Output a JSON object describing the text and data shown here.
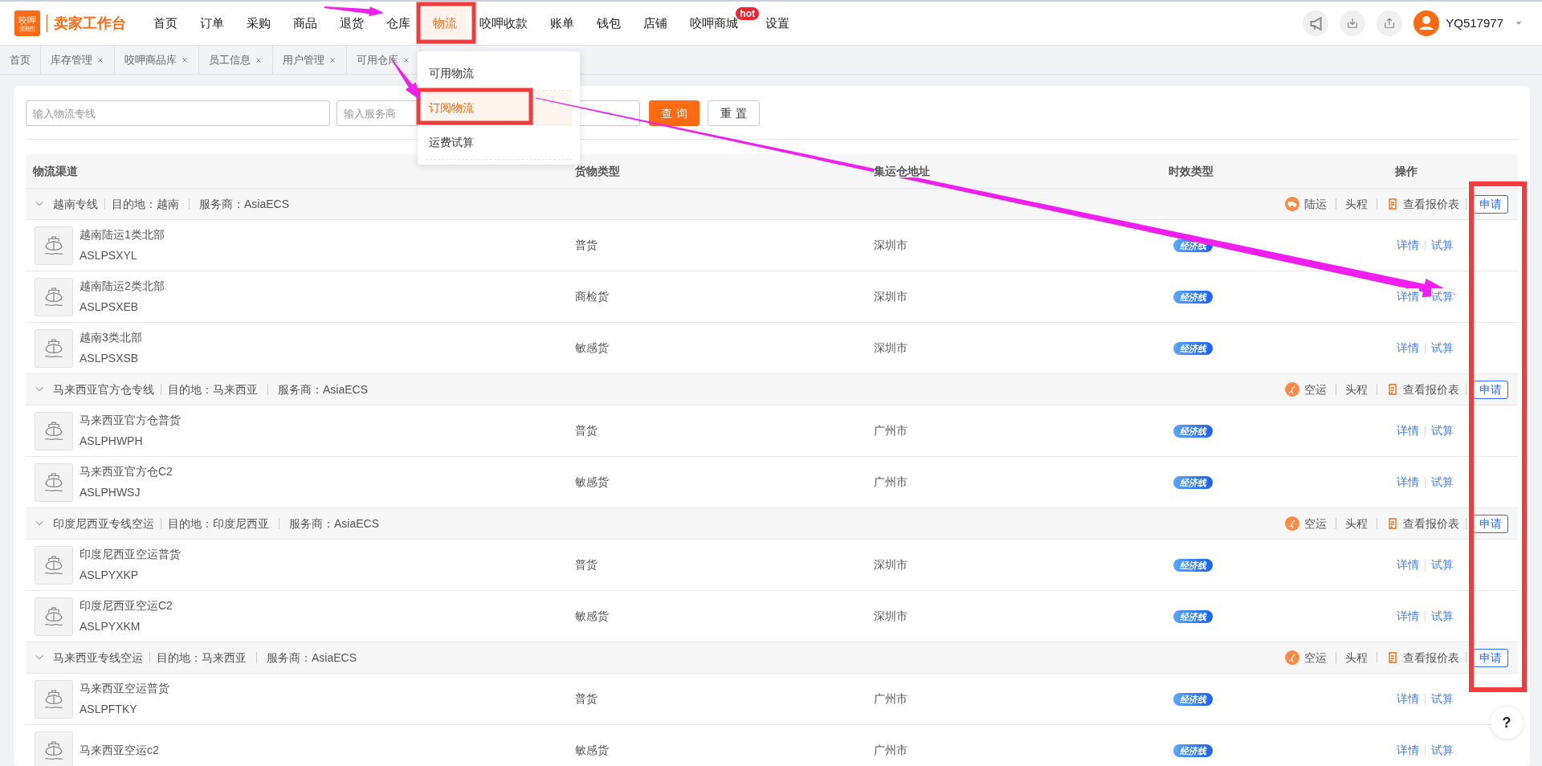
{
  "header": {
    "logo_mark": "咬呷",
    "logo_sub": "ERP",
    "app_title": "卖家工作台",
    "nav": [
      {
        "label": "首页",
        "selected": false
      },
      {
        "label": "订单",
        "selected": false
      },
      {
        "label": "采购",
        "selected": false
      },
      {
        "label": "商品",
        "selected": false
      },
      {
        "label": "退货",
        "selected": false
      },
      {
        "label": "仓库",
        "selected": false
      },
      {
        "label": "物流",
        "selected": true
      },
      {
        "label": "咬呷收款",
        "selected": false
      },
      {
        "label": "账单",
        "selected": false
      },
      {
        "label": "钱包",
        "selected": false
      },
      {
        "label": "店铺",
        "selected": false
      },
      {
        "label": "咬呷商城",
        "selected": false,
        "badge": "hot"
      },
      {
        "label": "设置",
        "selected": false
      }
    ],
    "user": "YQ517977"
  },
  "tabs": [
    {
      "label": "首页",
      "closable": false
    },
    {
      "label": "库存管理",
      "closable": true
    },
    {
      "label": "咬呷商品库",
      "closable": true
    },
    {
      "label": "员工信息",
      "closable": true
    },
    {
      "label": "用户管理",
      "closable": true
    },
    {
      "label": "可用仓库",
      "closable": true
    }
  ],
  "dropdown": {
    "items": [
      {
        "label": "可用物流",
        "selected": false
      },
      {
        "label": "订阅物流",
        "selected": true
      },
      {
        "label": "运费试算",
        "selected": false
      }
    ]
  },
  "filters": {
    "fields": [
      {
        "placeholder": "输入物流专线"
      },
      {
        "placeholder": "输入服务商"
      }
    ],
    "buttons": [
      {
        "label": "查询",
        "kind": "primary"
      },
      {
        "label": "重置",
        "kind": "default"
      }
    ]
  },
  "table": {
    "columns": [
      "物流渠道",
      "货物类型",
      "集运仓地址",
      "时效类型",
      "操作"
    ],
    "groups": [
      {
        "title": "越南专线",
        "destination": "目的地：越南",
        "provider": "服务商：AsiaECS",
        "expanded": true,
        "transport": {
          "kind": "land",
          "label": "陆运"
        },
        "leg": "头程",
        "quote": "查看报价表",
        "apply": "申请",
        "rows": [
          {
            "name": "越南陆运1类北部",
            "code": "ASLPSXYL",
            "cargo": "普货",
            "warehouse": "深圳市",
            "badge": "经济线",
            "actions": [
              "详情",
              "试算"
            ]
          },
          {
            "name": "越南陆运2类北部",
            "code": "ASLPSXEB",
            "cargo": "商检货",
            "warehouse": "深圳市",
            "badge": "经济线",
            "actions": [
              "详情",
              "试算"
            ]
          },
          {
            "name": "越南3类北部",
            "code": "ASLPSXSB",
            "cargo": "敏感货",
            "warehouse": "深圳市",
            "badge": "经济线",
            "actions": [
              "详情",
              "试算"
            ]
          }
        ]
      },
      {
        "title": "马来西亚官方仓专线",
        "destination": "目的地：马来西亚",
        "provider": "服务商：AsiaECS",
        "expanded": true,
        "transport": {
          "kind": "air",
          "label": "空运"
        },
        "leg": "头程",
        "quote": "查看报价表",
        "apply": "申请",
        "rows": [
          {
            "name": "马来西亚官方仓普货",
            "code": "ASLPHWPH",
            "cargo": "普货",
            "warehouse": "广州市",
            "badge": "经济线",
            "actions": [
              "详情",
              "试算"
            ]
          },
          {
            "name": "马来西亚官方仓C2",
            "code": "ASLPHWSJ",
            "cargo": "敏感货",
            "warehouse": "广州市",
            "badge": "经济线",
            "actions": [
              "详情",
              "试算"
            ]
          }
        ]
      },
      {
        "title": "印度尼西亚专线空运",
        "destination": "目的地：印度尼西亚",
        "provider": "服务商：AsiaECS",
        "expanded": true,
        "transport": {
          "kind": "air",
          "label": "空运"
        },
        "leg": "头程",
        "quote": "查看报价表",
        "apply": "申请",
        "rows": [
          {
            "name": "印度尼西亚空运普货",
            "code": "ASLPYXKP",
            "cargo": "普货",
            "warehouse": "深圳市",
            "badge": "经济线",
            "actions": [
              "详情",
              "试算"
            ]
          },
          {
            "name": "印度尼西亚空运C2",
            "code": "ASLPYXKM",
            "cargo": "敏感货",
            "warehouse": "深圳市",
            "badge": "经济线",
            "actions": [
              "详情",
              "试算"
            ]
          }
        ]
      },
      {
        "title": "马来西亚专线空运",
        "destination": "目的地：马来西亚",
        "provider": "服务商：AsiaECS",
        "expanded": true,
        "transport": {
          "kind": "air",
          "label": "空运"
        },
        "leg": "头程",
        "quote": "查看报价表",
        "apply": "申请",
        "rows": [
          {
            "name": "马来西亚空运普货",
            "code": "ASLPFTKY",
            "cargo": "普货",
            "warehouse": "广州市",
            "badge": "经济线",
            "actions": [
              "详情",
              "试算"
            ]
          },
          {
            "name": "马来西亚空运c2",
            "cargo": "敏感货",
            "warehouse": "广州市",
            "badge": "经济线",
            "actions": [
              "详情",
              "试算"
            ]
          }
        ]
      }
    ]
  },
  "help": "?"
}
